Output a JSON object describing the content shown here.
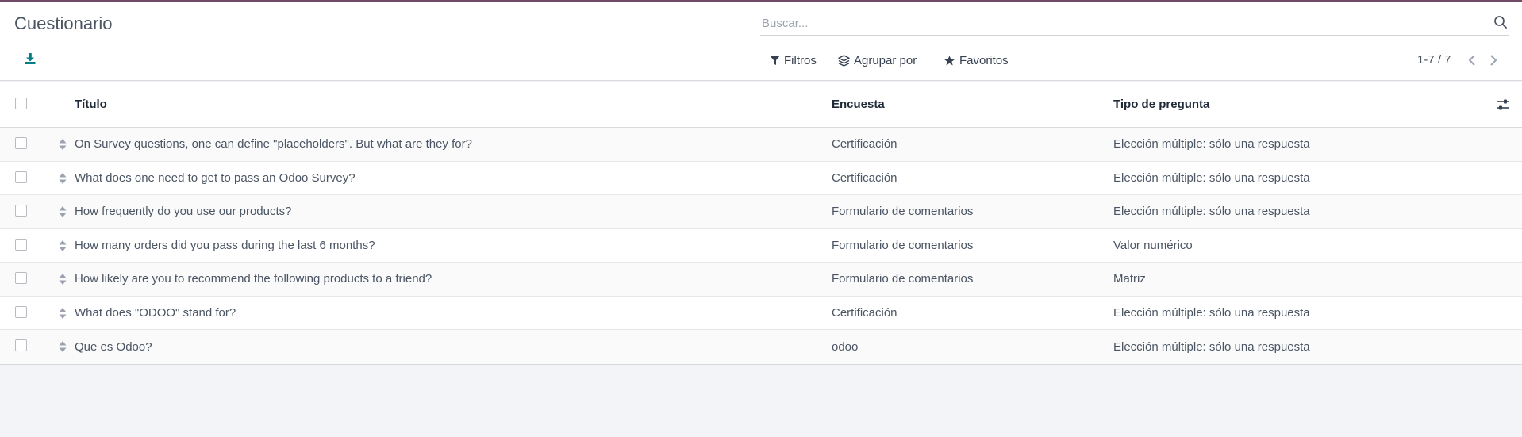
{
  "page": {
    "title": "Cuestionario"
  },
  "search": {
    "placeholder": "Buscar...",
    "value": ""
  },
  "filters": {
    "filters_label": "Filtros",
    "group_by_label": "Agrupar por",
    "favorites_label": "Favoritos"
  },
  "pager": {
    "value": "1-7 / 7"
  },
  "table": {
    "columns": {
      "title": "Título",
      "survey": "Encuesta",
      "type": "Tipo de pregunta"
    },
    "rows": [
      {
        "title": "On Survey questions, one can define \"placeholders\". But what are they for?",
        "survey": "Certificación",
        "type": "Elección múltiple: sólo una respuesta"
      },
      {
        "title": "What does one need to get to pass an Odoo Survey?",
        "survey": "Certificación",
        "type": "Elección múltiple: sólo una respuesta"
      },
      {
        "title": "How frequently do you use our products?",
        "survey": "Formulario de comentarios",
        "type": "Elección múltiple: sólo una respuesta"
      },
      {
        "title": "How many orders did you pass during the last 6 months?",
        "survey": "Formulario de comentarios",
        "type": "Valor numérico"
      },
      {
        "title": "How likely are you to recommend the following products to a friend?",
        "survey": "Formulario de comentarios",
        "type": "Matriz"
      },
      {
        "title": "What does \"ODOO\" stand for?",
        "survey": "Certificación",
        "type": "Elección múltiple: sólo una respuesta"
      },
      {
        "title": "Que es Odoo?",
        "survey": "odoo",
        "type": "Elección múltiple: sólo una respuesta"
      }
    ]
  },
  "icons": {
    "download": "download-icon",
    "search": "search-icon",
    "filter": "filter-icon",
    "group_by": "layers-icon",
    "favorites": "star-icon",
    "prev": "chevron-left-icon",
    "next": "chevron-right-icon",
    "drag": "drag-handle-icon",
    "optional_columns": "sliders-icon"
  },
  "colors": {
    "brand": "#714b67",
    "accent": "#017e84",
    "background": "#f3f4f7"
  }
}
